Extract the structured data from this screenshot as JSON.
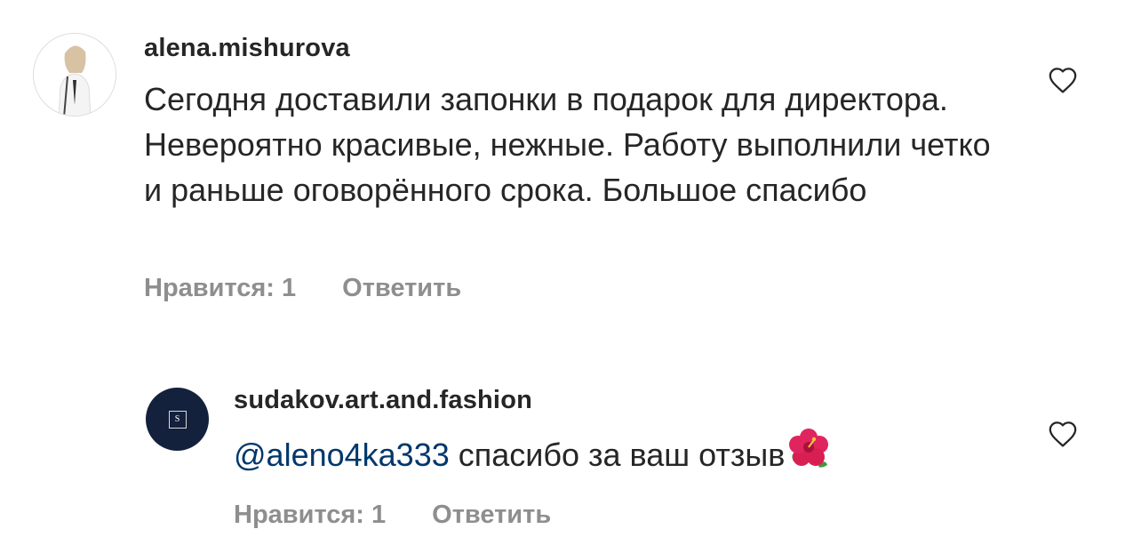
{
  "comments": [
    {
      "username": "alena.mishurova",
      "text": "Сегодня доставили запонки в подарок для директора. Невероятно красивые, нежные. Работу выполнили четко и раньше оговорённого срока. Большое спасибо",
      "likes_label": "Нравится: 1",
      "reply_label": "Ответить",
      "like_icon": "heart-outline-icon"
    }
  ],
  "reply": {
    "username": "sudakov.art.and.fashion",
    "avatar_monogram": "S",
    "mention": "@aleno4ka333",
    "text": " спасибо за ваш отзыв",
    "emoji": "hibiscus-icon",
    "likes_label": "Нравится: 1",
    "reply_label": "Ответить",
    "like_icon": "heart-outline-icon"
  },
  "colors": {
    "text": "#262626",
    "secondary": "#8e8e8e",
    "mention": "#00376b",
    "reply_avatar_bg": "#14213d"
  }
}
